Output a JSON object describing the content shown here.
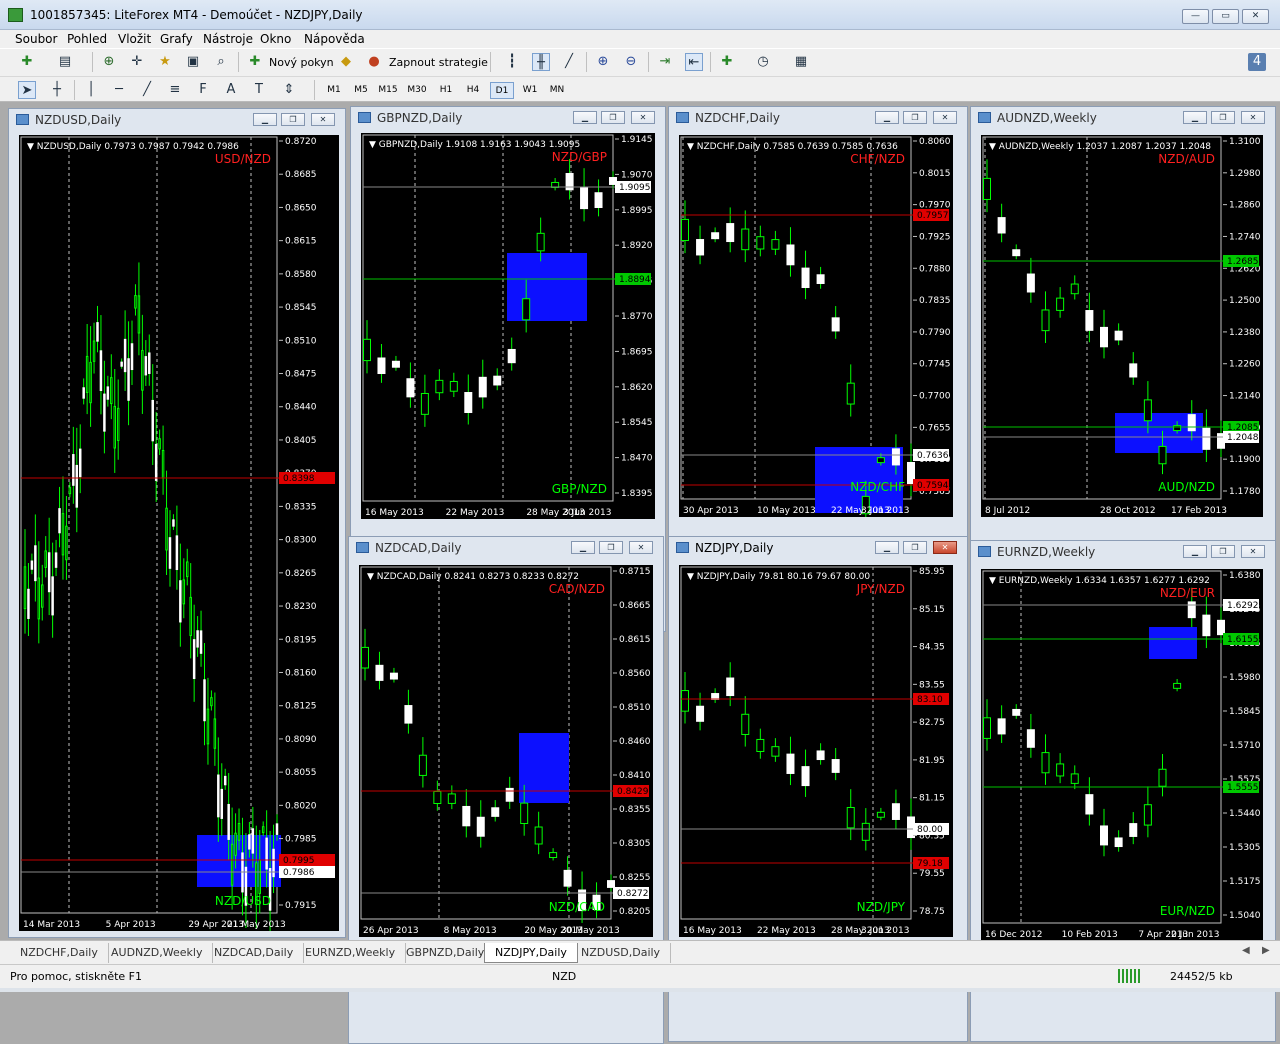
{
  "window": {
    "title": "1001857345: LiteForex MT4 - Demoúčet - NZDJPY,Daily"
  },
  "menu": [
    "Soubor",
    "Pohled",
    "Vložit",
    "Grafy",
    "Nástroje",
    "Okno",
    "Nápověda"
  ],
  "toolbar": {
    "new_order": "Nový pokyn",
    "strategy": "Zapnout strategie",
    "badge": "4"
  },
  "timeframes": [
    "M1",
    "M5",
    "M15",
    "M30",
    "H1",
    "H4",
    "D1",
    "W1",
    "MN"
  ],
  "active_timeframe": "D1",
  "charts": [
    {
      "id": "nzdusd",
      "title": "NZDUSD,Daily",
      "ohlc": "NZDUSD,Daily  0.7973 0.7987 0.7942 0.7986",
      "pair_top": "USD/NZD",
      "pair_bottom": "NZD/USD",
      "prices": [
        "0.8720",
        "0.8685",
        "0.8650",
        "0.8615",
        "0.8580",
        "0.8545",
        "0.8510",
        "0.8475",
        "0.8440",
        "0.8405",
        "0.8370",
        "0.8335",
        "0.8300",
        "0.8265",
        "0.8230",
        "0.8195",
        "0.8160",
        "0.8125",
        "0.8090",
        "0.8055",
        "0.8020",
        "0.7985",
        "0.7950",
        "0.7915"
      ],
      "red_label": "0.8398",
      "white_label": "0.7986",
      "red2_label": "0.7995",
      "dates": [
        "14 Mar 2013",
        "5 Apr 2013",
        "29 Apr 2013",
        "21 May 2013"
      ]
    },
    {
      "id": "gbpnzd",
      "title": "GBPNZD,Daily",
      "ohlc": "GBPNZD,Daily  1.9108 1.9163 1.9043 1.9095",
      "pair_top": "NZD/GBP",
      "pair_bottom": "GBP/NZD",
      "prices": [
        "1.9145",
        "1.9070",
        "1.8995",
        "1.8920",
        "1.8845",
        "1.8770",
        "1.8695",
        "1.8620",
        "1.8545",
        "1.8470",
        "1.8395"
      ],
      "white_label": "1.9095",
      "green_label": "1.8894",
      "dates": [
        "16 May 2013",
        "22 May 2013",
        "28 May 2013",
        "3 Jun 2013"
      ]
    },
    {
      "id": "nzdchf",
      "title": "NZDCHF,Daily",
      "ohlc": "NZDCHF,Daily  0.7585 0.7639 0.7585 0.7636",
      "pair_top": "CHF/NZD",
      "pair_bottom": "NZD/CHF",
      "prices": [
        "0.8060",
        "0.8015",
        "0.7970",
        "0.7925",
        "0.7880",
        "0.7835",
        "0.7790",
        "0.7745",
        "0.7700",
        "0.7655",
        "0.7610",
        "0.7565"
      ],
      "red_label": "0.7957",
      "white_label": "0.7636",
      "red2_label": "0.7594",
      "dates": [
        "30 Apr 2013",
        "10 May 2013",
        "22 May 2013",
        "3 Jun 2013"
      ]
    },
    {
      "id": "audnzd",
      "title": "AUDNZD,Weekly",
      "ohlc": "AUDNZD,Weekly  1.2037 1.2087 1.2037 1.2048",
      "pair_top": "NZD/AUD",
      "pair_bottom": "AUD/NZD",
      "prices": [
        "1.3100",
        "1.2980",
        "1.2860",
        "1.2740",
        "1.2620",
        "1.2500",
        "1.2380",
        "1.2260",
        "1.2140",
        "1.2020",
        "1.1900",
        "1.1780"
      ],
      "green_label": "1.2685",
      "green2_label": "1.2085",
      "white_label": "1.2048",
      "dates": [
        "8 Jul 2012",
        "28 Oct 2012",
        "17 Feb 2013"
      ]
    },
    {
      "id": "nzdcad",
      "title": "NZDCAD,Daily",
      "ohlc": "NZDCAD,Daily  0.8241 0.8273 0.8233 0.8272",
      "pair_top": "CAD/NZD",
      "pair_bottom": "NZD/CAD",
      "prices": [
        "0.8715",
        "0.8665",
        "0.8615",
        "0.8560",
        "0.8510",
        "0.8460",
        "0.8410",
        "0.8355",
        "0.8305",
        "0.8255",
        "0.8205"
      ],
      "red_label": "0.8429",
      "white_label": "0.8272",
      "dates": [
        "26 Apr 2013",
        "8 May 2013",
        "20 May 2013",
        "30 May 2013"
      ]
    },
    {
      "id": "nzdjpy",
      "title": "NZDJPY,Daily",
      "ohlc": "NZDJPY,Daily  79.81 80.16 79.67 80.00",
      "pair_top": "JPY/NZD",
      "pair_bottom": "NZD/JPY",
      "prices": [
        "85.95",
        "85.15",
        "84.35",
        "83.55",
        "82.75",
        "81.95",
        "81.15",
        "80.35",
        "79.55",
        "78.75"
      ],
      "red_label": "83.10",
      "white_label": "80.00",
      "red2_label": "79.18",
      "dates": [
        "16 May 2013",
        "22 May 2013",
        "28 May 2013",
        "3 Jun 2013"
      ]
    },
    {
      "id": "eurnzd",
      "title": "EURNZD,Weekly",
      "ohlc": "EURNZD,Weekly  1.6334 1.6357 1.6277 1.6292",
      "pair_top": "NZD/EUR",
      "pair_bottom": "EUR/NZD",
      "prices": [
        "1.6380",
        "1.6245",
        "1.6115",
        "1.5980",
        "1.5845",
        "1.5710",
        "1.5575",
        "1.5440",
        "1.5305",
        "1.5175",
        "1.5040"
      ],
      "white_label": "1.6292",
      "green_label": "1.6155",
      "green2_label": "1.5555",
      "dates": [
        "16 Dec 2012",
        "10 Feb 2013",
        "7 Apr 2013",
        "2 Jun 2013"
      ]
    }
  ],
  "tabs": [
    "NZDCHF,Daily",
    "AUDNZD,Weekly",
    "NZDCAD,Daily",
    "EURNZD,Weekly",
    "GBPNZD,Daily",
    "NZDJPY,Daily",
    "NZDUSD,Daily"
  ],
  "active_tab": "NZDJPY,Daily",
  "status": {
    "help": "Pro pomoc, stiskněte F1",
    "symbol": "NZD",
    "traffic": "24452/5 kb"
  }
}
